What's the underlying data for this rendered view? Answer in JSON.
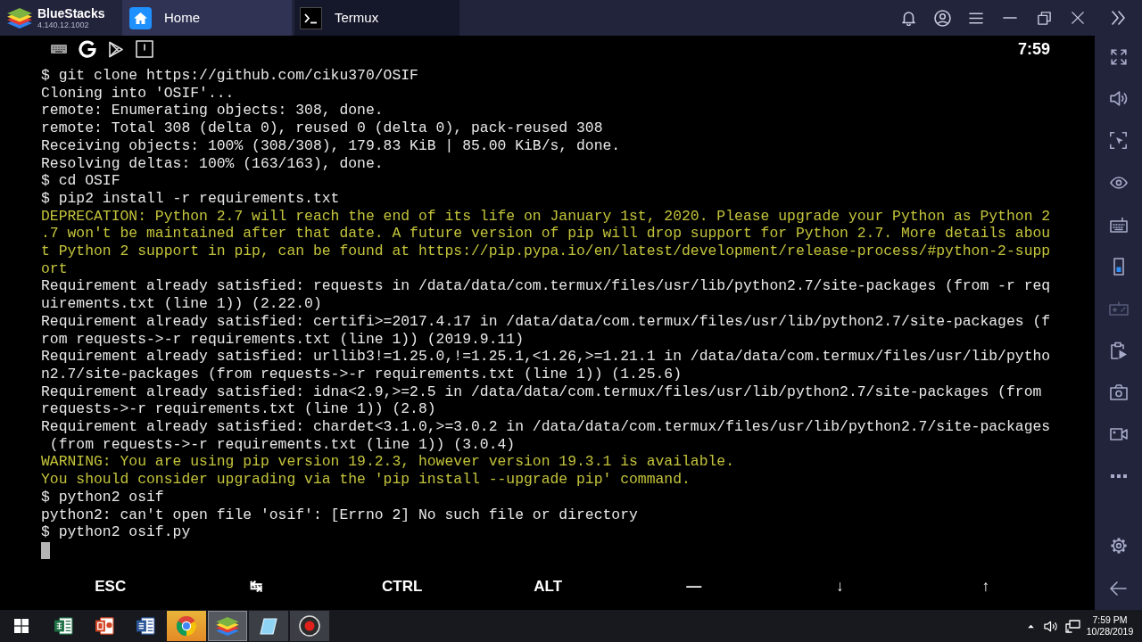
{
  "title_bar": {
    "app_name": "BlueStacks",
    "version": "4.140.12.1002",
    "tabs": [
      {
        "label": "Home",
        "kind": "home",
        "selected": false
      },
      {
        "label": "Termux",
        "kind": "terminal",
        "selected": true
      }
    ]
  },
  "status_bar": {
    "time": "7:59"
  },
  "terminal": {
    "lines": [
      {
        "kind": "output",
        "text": "$ git clone https://github.com/ciku370/OSIF"
      },
      {
        "kind": "output",
        "text": "Cloning into 'OSIF'..."
      },
      {
        "kind": "output",
        "text": "remote: Enumerating objects: 308, done."
      },
      {
        "kind": "output",
        "text": "remote: Total 308 (delta 0), reused 0 (delta 0), pack-reused 308"
      },
      {
        "kind": "output",
        "text": "Receiving objects: 100% (308/308), 179.83 KiB | 85.00 KiB/s, done."
      },
      {
        "kind": "output",
        "text": "Resolving deltas: 100% (163/163), done."
      },
      {
        "kind": "output",
        "text": "$ cd OSIF"
      },
      {
        "kind": "output",
        "text": "$ pip2 install -r requirements.txt"
      },
      {
        "kind": "warning",
        "text": "DEPRECATION: Python 2.7 will reach the end of its life on January 1st, 2020. Please upgrade your Python as Python 2.7 won't be maintained after that date. A future version of pip will drop support for Python 2.7. More details about Python 2 support in pip, can be found at https://pip.pypa.io/en/latest/development/release-process/#python-2-support"
      },
      {
        "kind": "output",
        "text": "Requirement already satisfied: requests in /data/data/com.termux/files/usr/lib/python2.7/site-packages (from -r requirements.txt (line 1)) (2.22.0)"
      },
      {
        "kind": "output",
        "text": "Requirement already satisfied: certifi>=2017.4.17 in /data/data/com.termux/files/usr/lib/python2.7/site-packages (from requests->-r requirements.txt (line 1)) (2019.9.11)"
      },
      {
        "kind": "output",
        "text": "Requirement already satisfied: urllib3!=1.25.0,!=1.25.1,<1.26,>=1.21.1 in /data/data/com.termux/files/usr/lib/python2.7/site-packages (from requests->-r requirements.txt (line 1)) (1.25.6)"
      },
      {
        "kind": "output",
        "text": "Requirement already satisfied: idna<2.9,>=2.5 in /data/data/com.termux/files/usr/lib/python2.7/site-packages (from requests->-r requirements.txt (line 1)) (2.8)"
      },
      {
        "kind": "output",
        "text": "Requirement already satisfied: chardet<3.1.0,>=3.0.2 in /data/data/com.termux/files/usr/lib/python2.7/site-packages (from requests->-r requirements.txt (line 1)) (3.0.4)"
      },
      {
        "kind": "warning",
        "text": "WARNING: You are using pip version 19.2.3, however version 19.3.1 is available."
      },
      {
        "kind": "warning",
        "text": "You should consider upgrading via the 'pip install --upgrade pip' command."
      },
      {
        "kind": "output",
        "text": "$ python2 osif"
      },
      {
        "kind": "output",
        "text": "python2: can't open file 'osif': [Errno 2] No such file or directory"
      },
      {
        "kind": "output",
        "text": "$ python2 osif.py"
      }
    ]
  },
  "extra_keys": [
    "ESC",
    "↹",
    "CTRL",
    "ALT",
    "—",
    "↓",
    "↑"
  ],
  "sidebar": {
    "items": [
      {
        "disabled": false
      },
      {
        "disabled": false
      },
      {
        "disabled": false
      },
      {
        "disabled": false
      },
      {
        "disabled": false
      },
      {
        "disabled": false
      },
      {
        "disabled": true
      },
      {
        "disabled": false
      },
      {
        "disabled": false
      },
      {
        "disabled": false
      },
      {
        "disabled": false
      },
      {
        "disabled": false
      },
      {
        "disabled": false
      }
    ]
  },
  "taskbar": {
    "apps": [
      {
        "open": false,
        "selected": false,
        "flashing": false
      },
      {
        "open": false,
        "selected": false,
        "flashing": false
      },
      {
        "open": false,
        "selected": false,
        "flashing": false
      },
      {
        "open": true,
        "selected": false,
        "flashing": true
      },
      {
        "open": true,
        "selected": true,
        "flashing": false
      },
      {
        "open": true,
        "selected": false,
        "flashing": false
      },
      {
        "open": true,
        "selected": false,
        "flashing": false
      }
    ],
    "time": "7:59 PM",
    "date": "10/28/2019"
  }
}
